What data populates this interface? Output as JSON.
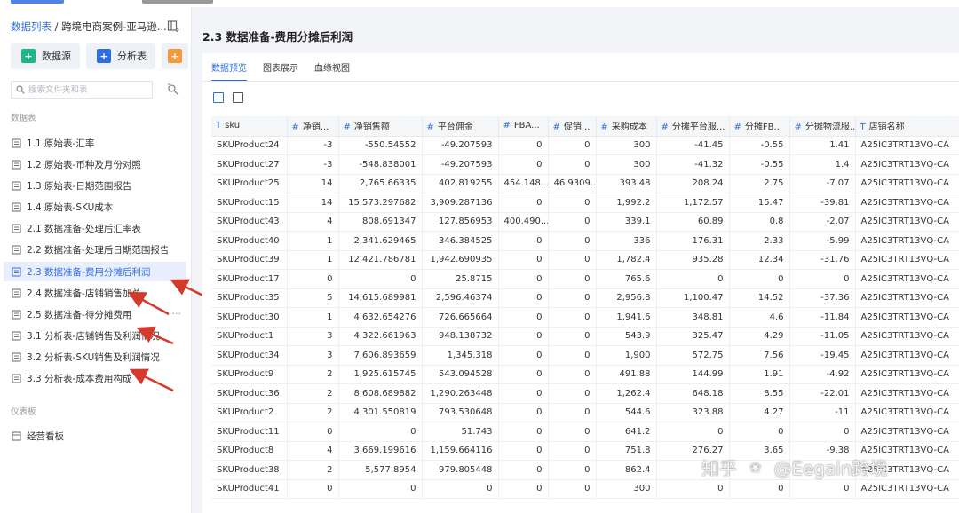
{
  "sidebar": {
    "breadcrumb_link": "数据列表",
    "breadcrumb_sep": " / ",
    "breadcrumb_current": "跨境电商案例-亚马逊...",
    "buttons": {
      "datasource": "数据源",
      "analysis": "分析表"
    },
    "search_placeholder": "搜索文件夹和表",
    "section_data": "数据表",
    "items": [
      {
        "label": "1.1 原始表-汇率"
      },
      {
        "label": "1.2 原始表-币种及月份对照"
      },
      {
        "label": "1.3 原始表-日期范围报告"
      },
      {
        "label": "1.4 原始表-SKU成本"
      },
      {
        "label": "2.1 数据准备-处理后汇率表"
      },
      {
        "label": "2.2 数据准备-处理后日期范围报告"
      },
      {
        "label": "2.3 数据准备-费用分摊后利润"
      },
      {
        "label": "2.4 数据准备-店铺销售加总"
      },
      {
        "label": "2.5 数据准备-待分摊费用"
      },
      {
        "label": "3.1 分析表-店铺销售及利润情况"
      },
      {
        "label": "3.2 分析表-SKU销售及利润情况"
      },
      {
        "label": "3.3 分析表-成本费用构成"
      }
    ],
    "more": "···",
    "section_dashboard": "仪表板",
    "dashboard_items": [
      {
        "label": "经营看板"
      }
    ]
  },
  "main": {
    "title": "2.3 数据准备-费用分摊后利润",
    "tabs": [
      "数据预览",
      "图表展示",
      "血缘视图"
    ],
    "columns": [
      {
        "type": "T",
        "name": "sku"
      },
      {
        "type": "#",
        "name": "净销..."
      },
      {
        "type": "#",
        "name": "净销售额"
      },
      {
        "type": "#",
        "name": "平台佣金"
      },
      {
        "type": "#",
        "name": "FBA..."
      },
      {
        "type": "#",
        "name": "促销..."
      },
      {
        "type": "#",
        "name": "采购成本"
      },
      {
        "type": "#",
        "name": "分摊平台服..."
      },
      {
        "type": "#",
        "name": "分摊FB..."
      },
      {
        "type": "#",
        "name": "分摊物流服..."
      },
      {
        "type": "T",
        "name": "店铺名称"
      }
    ],
    "rows": [
      [
        "SKUProduct24",
        "-3",
        "-550.54552",
        "-49.207593",
        "0",
        "0",
        "300",
        "-41.45",
        "-0.55",
        "1.41",
        "A25IC3TRT13VQ-CA"
      ],
      [
        "SKUProduct27",
        "-3",
        "-548.838001",
        "-49.207593",
        "0",
        "0",
        "300",
        "-41.32",
        "-0.55",
        "1.4",
        "A25IC3TRT13VQ-CA"
      ],
      [
        "SKUProduct25",
        "14",
        "2,765.66335",
        "402.819255",
        "454.148...",
        "46.9309...",
        "393.48",
        "208.24",
        "2.75",
        "-7.07",
        "A25IC3TRT13VQ-CA"
      ],
      [
        "SKUProduct15",
        "14",
        "15,573.297682",
        "3,909.287136",
        "0",
        "0",
        "1,992.2",
        "1,172.57",
        "15.47",
        "-39.81",
        "A25IC3TRT13VQ-CA"
      ],
      [
        "SKUProduct43",
        "4",
        "808.691347",
        "127.856953",
        "400.490...",
        "0",
        "339.1",
        "60.89",
        "0.8",
        "-2.07",
        "A25IC3TRT13VQ-CA"
      ],
      [
        "SKUProduct40",
        "1",
        "2,341.629465",
        "346.384525",
        "0",
        "0",
        "336",
        "176.31",
        "2.33",
        "-5.99",
        "A25IC3TRT13VQ-CA"
      ],
      [
        "SKUProduct39",
        "1",
        "12,421.786781",
        "1,942.690935",
        "0",
        "0",
        "1,782.4",
        "935.28",
        "12.34",
        "-31.76",
        "A25IC3TRT13VQ-CA"
      ],
      [
        "SKUProduct17",
        "0",
        "0",
        "25.8715",
        "0",
        "0",
        "765.6",
        "0",
        "0",
        "0",
        "A25IC3TRT13VQ-CA"
      ],
      [
        "SKUProduct35",
        "5",
        "14,615.689981",
        "2,596.46374",
        "0",
        "0",
        "2,956.8",
        "1,100.47",
        "14.52",
        "-37.36",
        "A25IC3TRT13VQ-CA"
      ],
      [
        "SKUProduct30",
        "1",
        "4,632.654276",
        "726.665664",
        "0",
        "0",
        "1,941.6",
        "348.81",
        "4.6",
        "-11.84",
        "A25IC3TRT13VQ-CA"
      ],
      [
        "SKUProduct1",
        "3",
        "4,322.661963",
        "948.138732",
        "0",
        "0",
        "543.9",
        "325.47",
        "4.29",
        "-11.05",
        "A25IC3TRT13VQ-CA"
      ],
      [
        "SKUProduct34",
        "3",
        "7,606.893659",
        "1,345.318",
        "0",
        "0",
        "1,900",
        "572.75",
        "7.56",
        "-19.45",
        "A25IC3TRT13VQ-CA"
      ],
      [
        "SKUProduct9",
        "2",
        "1,925.615745",
        "543.094528",
        "0",
        "0",
        "491.88",
        "144.99",
        "1.91",
        "-4.92",
        "A25IC3TRT13VQ-CA"
      ],
      [
        "SKUProduct36",
        "2",
        "8,608.689882",
        "1,290.263448",
        "0",
        "0",
        "1,262.4",
        "648.18",
        "8.55",
        "-22.01",
        "A25IC3TRT13VQ-CA"
      ],
      [
        "SKUProduct2",
        "2",
        "4,301.550819",
        "793.530648",
        "0",
        "0",
        "544.6",
        "323.88",
        "4.27",
        "-11",
        "A25IC3TRT13VQ-CA"
      ],
      [
        "SKUProduct11",
        "0",
        "0",
        "51.743",
        "0",
        "0",
        "641.2",
        "0",
        "0",
        "0",
        "A25IC3TRT13VQ-CA"
      ],
      [
        "SKUProduct8",
        "4",
        "3,669.199616",
        "1,159.664116",
        "0",
        "0",
        "751.8",
        "276.27",
        "3.65",
        "-9.38",
        "A25IC3TRT13VQ-CA"
      ],
      [
        "SKUProduct38",
        "2",
        "5,577.8954",
        "979.805448",
        "0",
        "0",
        "862.4",
        "",
        "",
        "",
        "A25IC3TRT13VQ-CA"
      ],
      [
        "SKUProduct41",
        "0",
        "0",
        "0",
        "0",
        "0",
        "300",
        "0",
        "0",
        "0",
        "A25IC3TRT13VQ-CA"
      ]
    ]
  },
  "watermark": {
    "site": "知乎",
    "author": "@Eegain跨境"
  },
  "colors": {
    "accent": "#2f6ee0",
    "arrow": "#d33a2c",
    "datasource": "#1fb58a",
    "add": "#f39a3c"
  }
}
